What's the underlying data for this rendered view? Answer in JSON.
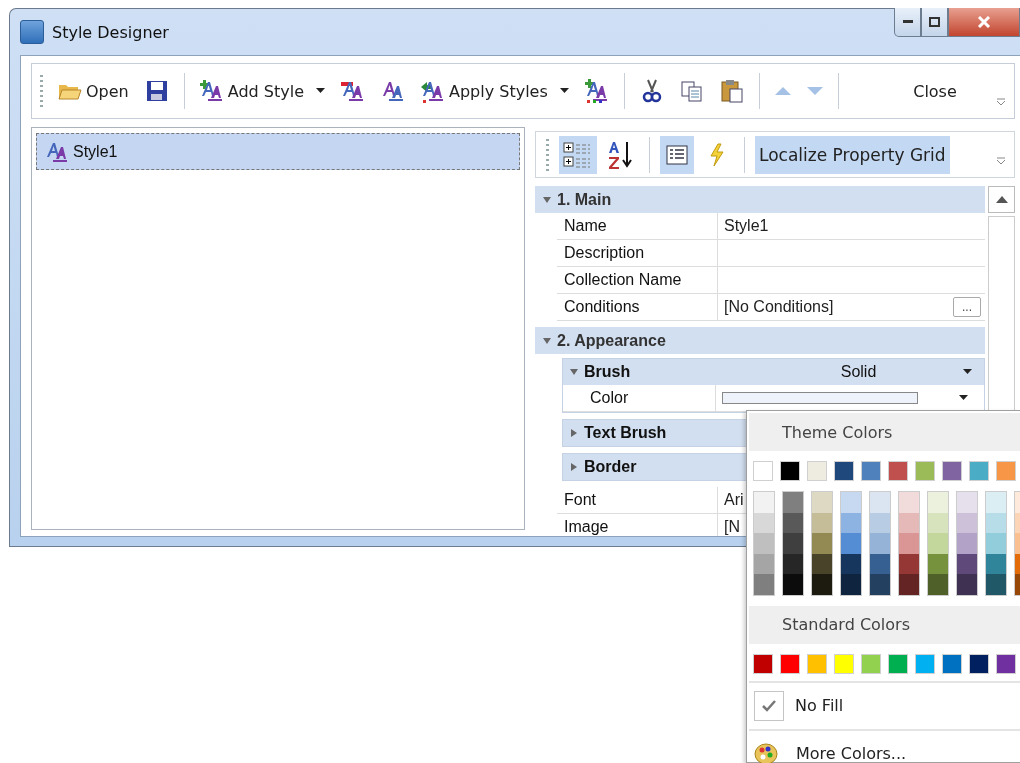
{
  "window": {
    "title": "Style Designer"
  },
  "toolbar": [
    {
      "kind": "open",
      "label": "Open",
      "disabled": false
    },
    {
      "kind": "save",
      "disabled": false
    },
    {
      "kind": "separator"
    },
    {
      "kind": "add_style",
      "label": "Add Style",
      "dropdown": true,
      "disabled": false
    },
    {
      "kind": "edit_style",
      "disabled": false
    },
    {
      "kind": "duplicate_style",
      "disabled": false
    },
    {
      "kind": "apply_styles",
      "label": "Apply Styles",
      "dropdown": true,
      "disabled": false
    },
    {
      "kind": "apply_all",
      "disabled": false
    },
    {
      "kind": "separator"
    },
    {
      "kind": "cut",
      "disabled": false
    },
    {
      "kind": "copy",
      "disabled": false
    },
    {
      "kind": "paste",
      "disabled": false
    },
    {
      "kind": "separator"
    },
    {
      "kind": "move_up",
      "disabled": true
    },
    {
      "kind": "move_down",
      "disabled": true
    },
    {
      "kind": "separator"
    },
    {
      "kind": "close",
      "label": "Close",
      "disabled": false
    }
  ],
  "style_list": [
    {
      "label": "Style1",
      "selected": true
    }
  ],
  "property_toolbar": [
    {
      "kind": "categorized",
      "selected": true
    },
    {
      "kind": "alphabetical",
      "selected": false
    },
    {
      "kind": "separator"
    },
    {
      "kind": "properties",
      "selected": true
    },
    {
      "kind": "events",
      "selected": false
    },
    {
      "kind": "separator"
    },
    {
      "kind": "text",
      "label": "Localize Property Grid",
      "selected": true
    }
  ],
  "property_grid": [
    {
      "label": "1. Main",
      "expanded": true,
      "children": [
        {
          "kind": "property",
          "name": "Name",
          "value": "Style1"
        },
        {
          "kind": "property",
          "name": "Description"
        },
        {
          "kind": "property",
          "name": "Collection Name"
        },
        {
          "kind": "property",
          "name": "Conditions",
          "value": "[No Conditions]",
          "editor_button": "..."
        }
      ]
    },
    {
      "label": "2. Appearance",
      "expanded": true,
      "children": [
        {
          "kind": "group",
          "label": "Brush",
          "value": "Solid",
          "dropdown": true,
          "expanded": true,
          "children": [
            {
              "kind": "color",
              "name": "Color",
              "dropdown": true
            }
          ]
        },
        {
          "kind": "group",
          "label": "Text Brush",
          "expanded": false
        },
        {
          "kind": "group",
          "label": "Border",
          "expanded": false
        },
        {
          "kind": "property",
          "name": "Font",
          "value": "Ari"
        },
        {
          "kind": "property",
          "name": "Image",
          "value": "[N"
        }
      ]
    }
  ],
  "color_picker": {
    "theme_title": "Theme Colors",
    "theme_colors": [
      {
        "color": "#ffffff",
        "shades": [
          {
            "color": "#f2f2f2"
          },
          {
            "color": "#d8d8d8"
          },
          {
            "color": "#bfbfbf"
          },
          {
            "color": "#a5a5a5"
          },
          {
            "color": "#7f7f7f"
          }
        ]
      },
      {
        "color": "#000000",
        "shades": [
          {
            "color": "#7f7f7f"
          },
          {
            "color": "#595959"
          },
          {
            "color": "#3f3f3f"
          },
          {
            "color": "#262626"
          },
          {
            "color": "#0c0c0c"
          }
        ]
      },
      {
        "color": "#eeece1",
        "shades": [
          {
            "color": "#ddd9c3"
          },
          {
            "color": "#c4bd97"
          },
          {
            "color": "#938953"
          },
          {
            "color": "#494429"
          },
          {
            "color": "#1d1b10"
          }
        ]
      },
      {
        "color": "#1f497d",
        "shades": [
          {
            "color": "#c6d9f0"
          },
          {
            "color": "#8db3e2"
          },
          {
            "color": "#548dd4"
          },
          {
            "color": "#17365d"
          },
          {
            "color": "#0f243e"
          }
        ]
      },
      {
        "color": "#4f81bd",
        "shades": [
          {
            "color": "#dbe5f1"
          },
          {
            "color": "#b8cce4"
          },
          {
            "color": "#95b3d7"
          },
          {
            "color": "#366092"
          },
          {
            "color": "#244061"
          }
        ]
      },
      {
        "color": "#c0504d",
        "shades": [
          {
            "color": "#f2dcdb"
          },
          {
            "color": "#e5b9b7"
          },
          {
            "color": "#d99694"
          },
          {
            "color": "#953734"
          },
          {
            "color": "#632423"
          }
        ]
      },
      {
        "color": "#9bbb59",
        "shades": [
          {
            "color": "#ebf1dd"
          },
          {
            "color": "#d7e3bc"
          },
          {
            "color": "#c3d69b"
          },
          {
            "color": "#76923c"
          },
          {
            "color": "#4f6128"
          }
        ]
      },
      {
        "color": "#8064a2",
        "shades": [
          {
            "color": "#e5e0ec"
          },
          {
            "color": "#ccc1d9"
          },
          {
            "color": "#b2a2c7"
          },
          {
            "color": "#5f497a"
          },
          {
            "color": "#3f3151"
          }
        ]
      },
      {
        "color": "#4bacc6",
        "shades": [
          {
            "color": "#dbeef3"
          },
          {
            "color": "#b7dde8"
          },
          {
            "color": "#92cddc"
          },
          {
            "color": "#31859b"
          },
          {
            "color": "#205867"
          }
        ]
      },
      {
        "color": "#f79646",
        "shades": [
          {
            "color": "#fdeada"
          },
          {
            "color": "#fbd5b5"
          },
          {
            "color": "#fac08f"
          },
          {
            "color": "#e36c09"
          },
          {
            "color": "#974806"
          }
        ]
      }
    ],
    "standard_title": "Standard Colors",
    "standard_colors": [
      {
        "color": "#c00000"
      },
      {
        "color": "#ff0000"
      },
      {
        "color": "#ffc000"
      },
      {
        "color": "#ffff00"
      },
      {
        "color": "#92d050"
      },
      {
        "color": "#00b050"
      },
      {
        "color": "#00b0f0"
      },
      {
        "color": "#0070c0"
      },
      {
        "color": "#002060"
      },
      {
        "color": "#7030a0"
      }
    ],
    "no_fill": {
      "label": "No Fill",
      "checked": true
    },
    "more_colors": {
      "label": "More Colors..."
    }
  }
}
